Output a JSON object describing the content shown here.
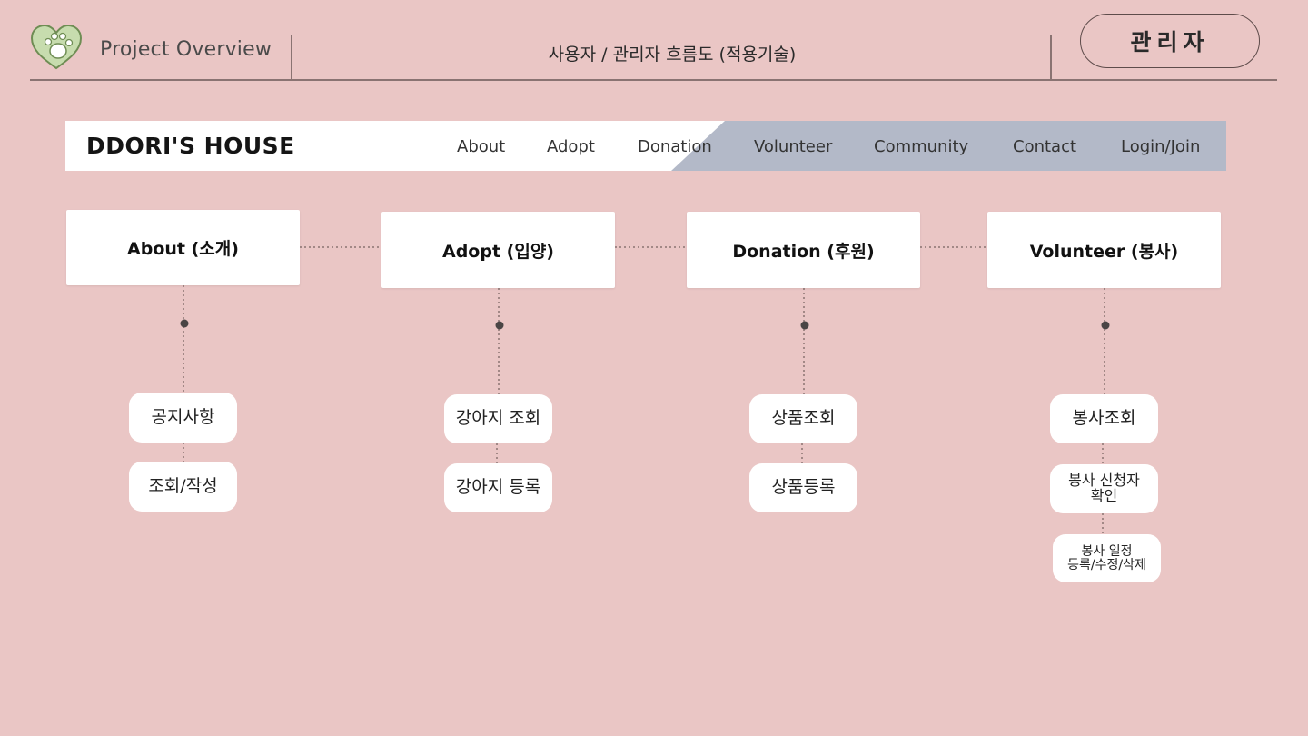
{
  "header": {
    "project_title": "Project Overview",
    "flow_title": "사용자 / 관리자 흐름도 (적용기술)",
    "admin_label": "관리자",
    "logo_icon": "paw-heart-icon"
  },
  "navbar": {
    "brand": "DDORI'S HOUSE",
    "links": [
      "About",
      "Adopt",
      "Donation",
      "Volunteer",
      "Community",
      "Contact",
      "Login/Join"
    ],
    "shade_color": "#b3b9c8"
  },
  "diagram": {
    "sections": [
      {
        "title": "About (소개)",
        "items": [
          "공지사항",
          "조회/작성"
        ]
      },
      {
        "title": "Adopt (입양)",
        "items": [
          "강아지 조회",
          "강아지 등록"
        ]
      },
      {
        "title": "Donation (후원)",
        "items": [
          "상품조회",
          "상품등록"
        ]
      },
      {
        "title": "Volunteer (봉사)",
        "items": [
          "봉사조회",
          "봉사 신청자\n확인",
          "봉사 일정\n등록/수정/삭제"
        ]
      }
    ]
  },
  "colors": {
    "background": "#eac6c5",
    "line": "#8a7372",
    "box": "#ffffff"
  }
}
